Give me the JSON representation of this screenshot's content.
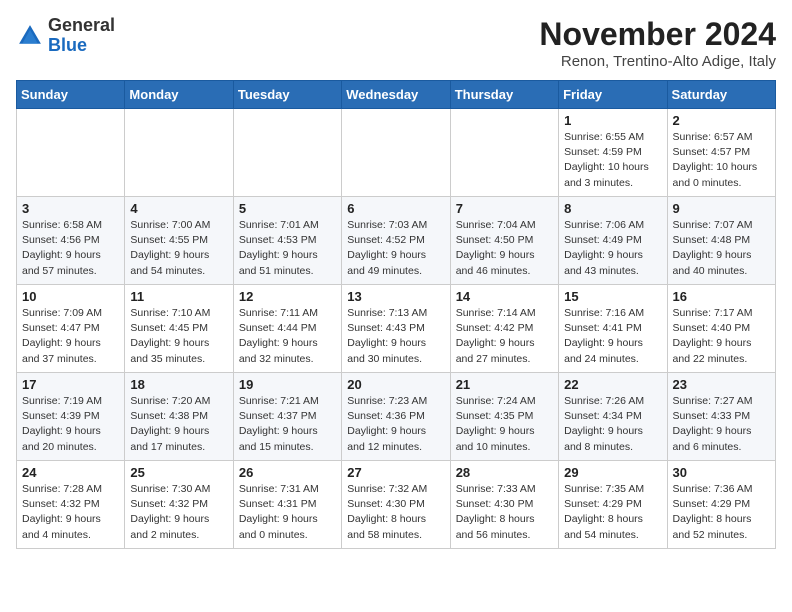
{
  "header": {
    "logo_general": "General",
    "logo_blue": "Blue",
    "month_title": "November 2024",
    "subtitle": "Renon, Trentino-Alto Adige, Italy"
  },
  "weekdays": [
    "Sunday",
    "Monday",
    "Tuesday",
    "Wednesday",
    "Thursday",
    "Friday",
    "Saturday"
  ],
  "weeks": [
    [
      {
        "day": "",
        "info": ""
      },
      {
        "day": "",
        "info": ""
      },
      {
        "day": "",
        "info": ""
      },
      {
        "day": "",
        "info": ""
      },
      {
        "day": "",
        "info": ""
      },
      {
        "day": "1",
        "info": "Sunrise: 6:55 AM\nSunset: 4:59 PM\nDaylight: 10 hours\nand 3 minutes."
      },
      {
        "day": "2",
        "info": "Sunrise: 6:57 AM\nSunset: 4:57 PM\nDaylight: 10 hours\nand 0 minutes."
      }
    ],
    [
      {
        "day": "3",
        "info": "Sunrise: 6:58 AM\nSunset: 4:56 PM\nDaylight: 9 hours\nand 57 minutes."
      },
      {
        "day": "4",
        "info": "Sunrise: 7:00 AM\nSunset: 4:55 PM\nDaylight: 9 hours\nand 54 minutes."
      },
      {
        "day": "5",
        "info": "Sunrise: 7:01 AM\nSunset: 4:53 PM\nDaylight: 9 hours\nand 51 minutes."
      },
      {
        "day": "6",
        "info": "Sunrise: 7:03 AM\nSunset: 4:52 PM\nDaylight: 9 hours\nand 49 minutes."
      },
      {
        "day": "7",
        "info": "Sunrise: 7:04 AM\nSunset: 4:50 PM\nDaylight: 9 hours\nand 46 minutes."
      },
      {
        "day": "8",
        "info": "Sunrise: 7:06 AM\nSunset: 4:49 PM\nDaylight: 9 hours\nand 43 minutes."
      },
      {
        "day": "9",
        "info": "Sunrise: 7:07 AM\nSunset: 4:48 PM\nDaylight: 9 hours\nand 40 minutes."
      }
    ],
    [
      {
        "day": "10",
        "info": "Sunrise: 7:09 AM\nSunset: 4:47 PM\nDaylight: 9 hours\nand 37 minutes."
      },
      {
        "day": "11",
        "info": "Sunrise: 7:10 AM\nSunset: 4:45 PM\nDaylight: 9 hours\nand 35 minutes."
      },
      {
        "day": "12",
        "info": "Sunrise: 7:11 AM\nSunset: 4:44 PM\nDaylight: 9 hours\nand 32 minutes."
      },
      {
        "day": "13",
        "info": "Sunrise: 7:13 AM\nSunset: 4:43 PM\nDaylight: 9 hours\nand 30 minutes."
      },
      {
        "day": "14",
        "info": "Sunrise: 7:14 AM\nSunset: 4:42 PM\nDaylight: 9 hours\nand 27 minutes."
      },
      {
        "day": "15",
        "info": "Sunrise: 7:16 AM\nSunset: 4:41 PM\nDaylight: 9 hours\nand 24 minutes."
      },
      {
        "day": "16",
        "info": "Sunrise: 7:17 AM\nSunset: 4:40 PM\nDaylight: 9 hours\nand 22 minutes."
      }
    ],
    [
      {
        "day": "17",
        "info": "Sunrise: 7:19 AM\nSunset: 4:39 PM\nDaylight: 9 hours\nand 20 minutes."
      },
      {
        "day": "18",
        "info": "Sunrise: 7:20 AM\nSunset: 4:38 PM\nDaylight: 9 hours\nand 17 minutes."
      },
      {
        "day": "19",
        "info": "Sunrise: 7:21 AM\nSunset: 4:37 PM\nDaylight: 9 hours\nand 15 minutes."
      },
      {
        "day": "20",
        "info": "Sunrise: 7:23 AM\nSunset: 4:36 PM\nDaylight: 9 hours\nand 12 minutes."
      },
      {
        "day": "21",
        "info": "Sunrise: 7:24 AM\nSunset: 4:35 PM\nDaylight: 9 hours\nand 10 minutes."
      },
      {
        "day": "22",
        "info": "Sunrise: 7:26 AM\nSunset: 4:34 PM\nDaylight: 9 hours\nand 8 minutes."
      },
      {
        "day": "23",
        "info": "Sunrise: 7:27 AM\nSunset: 4:33 PM\nDaylight: 9 hours\nand 6 minutes."
      }
    ],
    [
      {
        "day": "24",
        "info": "Sunrise: 7:28 AM\nSunset: 4:32 PM\nDaylight: 9 hours\nand 4 minutes."
      },
      {
        "day": "25",
        "info": "Sunrise: 7:30 AM\nSunset: 4:32 PM\nDaylight: 9 hours\nand 2 minutes."
      },
      {
        "day": "26",
        "info": "Sunrise: 7:31 AM\nSunset: 4:31 PM\nDaylight: 9 hours\nand 0 minutes."
      },
      {
        "day": "27",
        "info": "Sunrise: 7:32 AM\nSunset: 4:30 PM\nDaylight: 8 hours\nand 58 minutes."
      },
      {
        "day": "28",
        "info": "Sunrise: 7:33 AM\nSunset: 4:30 PM\nDaylight: 8 hours\nand 56 minutes."
      },
      {
        "day": "29",
        "info": "Sunrise: 7:35 AM\nSunset: 4:29 PM\nDaylight: 8 hours\nand 54 minutes."
      },
      {
        "day": "30",
        "info": "Sunrise: 7:36 AM\nSunset: 4:29 PM\nDaylight: 8 hours\nand 52 minutes."
      }
    ]
  ]
}
